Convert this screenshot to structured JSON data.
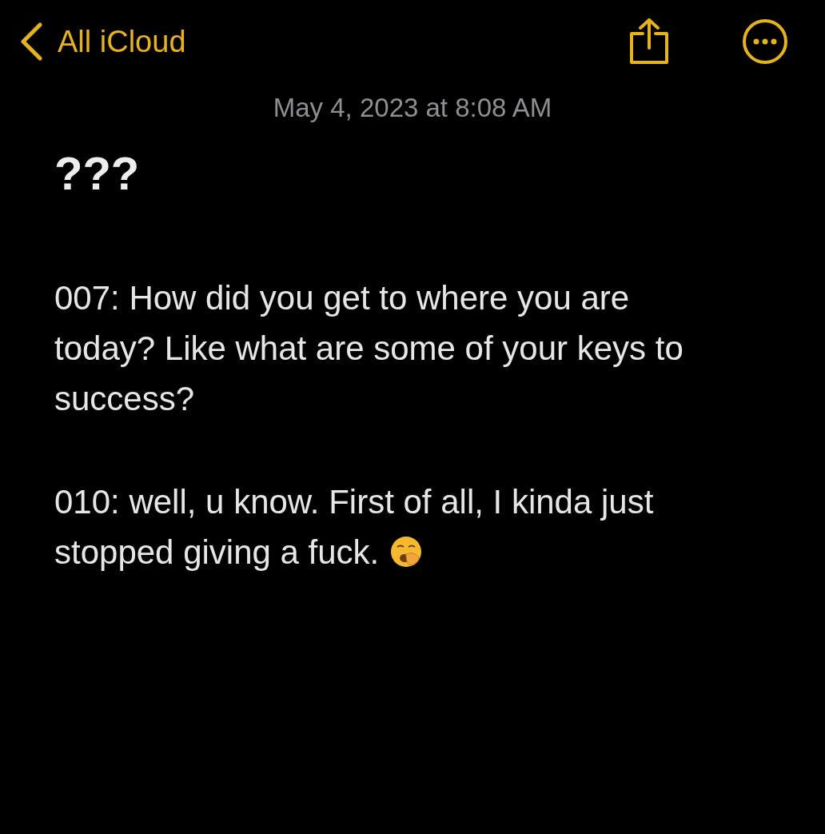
{
  "nav": {
    "back_label": "All iCloud"
  },
  "note": {
    "date": "May 4, 2023 at 8:08 AM",
    "title": "???",
    "paragraphs": [
      {
        "text": "007: How did you get to where you are today? Like what are some of your keys to success?",
        "emoji": false
      },
      {
        "text": "010: well, u know. First of all, I kinda just stopped giving a fuck.",
        "emoji": true
      }
    ]
  }
}
